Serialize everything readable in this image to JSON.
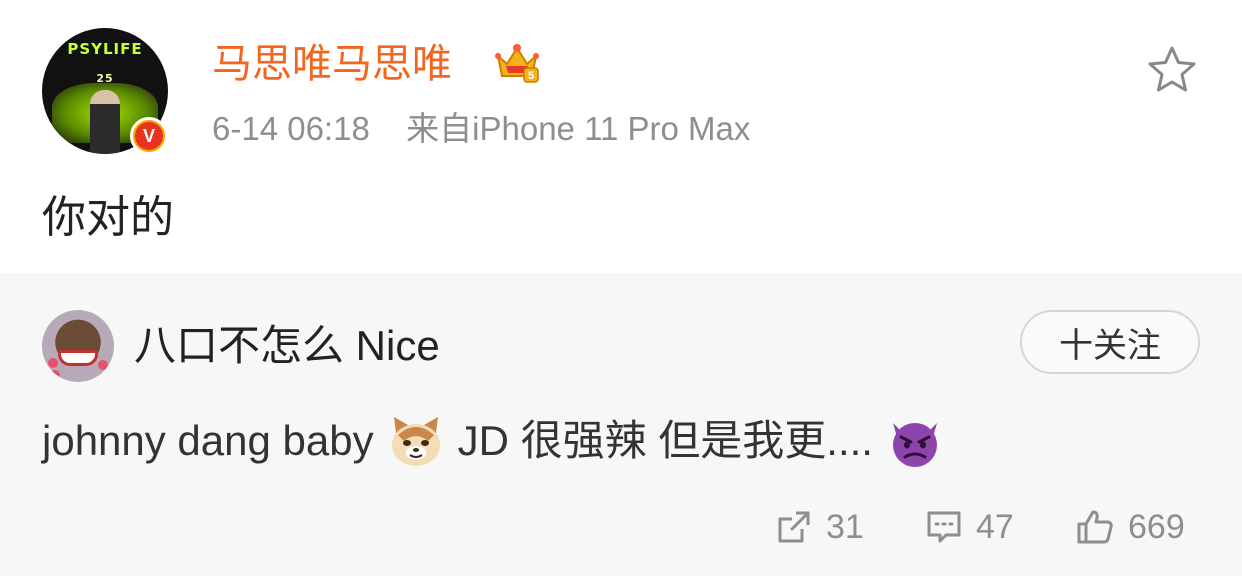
{
  "post": {
    "author": "马思唯马思唯",
    "timestamp": "6-14 06:18",
    "source": "来自iPhone 11 Pro Max",
    "content": "你对的",
    "avatar_text_1": "PSYLIFE",
    "avatar_text_2": "25",
    "verified_badge": "V",
    "icons": {
      "crown": "vip-crown-icon",
      "star": "star-icon"
    },
    "colors": {
      "author": "#f2661f",
      "badge": "#e8341f"
    }
  },
  "repost": {
    "username": "八口不怎么 Nice",
    "follow_label": "十关注",
    "text_part1": "johnny dang baby",
    "text_part2": "JD 很强辣 但是我更....",
    "emojis": [
      "cat-face-icon",
      "devil-face-icon"
    ],
    "actions": {
      "share": {
        "icon": "share-icon",
        "count": "31"
      },
      "comment": {
        "icon": "comment-icon",
        "count": "47"
      },
      "like": {
        "icon": "thumbs-up-icon",
        "count": "669"
      }
    }
  }
}
